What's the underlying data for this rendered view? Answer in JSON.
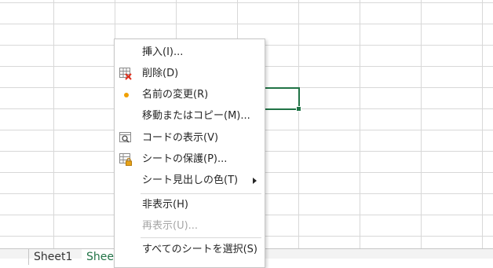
{
  "sheet_tabs": [
    {
      "label": "Sheet1"
    },
    {
      "label": "Shee"
    }
  ],
  "context_menu": {
    "items": [
      {
        "label": "挿入(I)...",
        "icon": "none"
      },
      {
        "label": "削除(D)",
        "icon": "delete-sheet-icon"
      },
      {
        "label": "名前の変更(R)",
        "icon": "rename-dot-icon"
      },
      {
        "label": "移動またはコピー(M)...",
        "icon": "none"
      },
      {
        "label": "コードの表示(V)",
        "icon": "view-code-icon"
      },
      {
        "label": "シートの保護(P)...",
        "icon": "protect-sheet-icon"
      },
      {
        "label": "シート見出しの色(T)",
        "icon": "none",
        "submenu": true
      },
      {
        "label": "非表示(H)",
        "icon": "none"
      },
      {
        "label": "再表示(U)...",
        "icon": "none",
        "disabled": true
      },
      {
        "label": "すべてのシートを選択(S)",
        "icon": "none"
      }
    ]
  },
  "colors": {
    "accent": "#217346",
    "rename_dot": "#f0a000",
    "delete_x": "#e0301e"
  }
}
